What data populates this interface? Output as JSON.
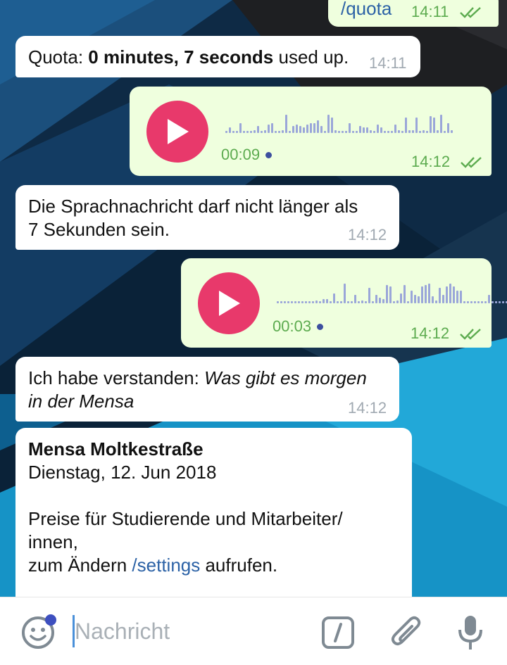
{
  "messages": [
    {
      "id": "m0",
      "dir": "out",
      "text": "/quota",
      "time": "14:11",
      "read": true
    },
    {
      "id": "m1",
      "dir": "in",
      "text_prefix": "Quota: ",
      "text_bold": "0 minutes, 7 seconds",
      "text_suffix": " used up.",
      "time": "14:11"
    },
    {
      "id": "m2",
      "dir": "out",
      "type": "voice",
      "duration": "00:09",
      "time": "14:12",
      "read": true
    },
    {
      "id": "m3",
      "dir": "in",
      "line1": "Die Sprachnachricht darf nicht länger als",
      "line2": "7 Sekunden sein.",
      "time": "14:12"
    },
    {
      "id": "m4",
      "dir": "out",
      "type": "voice",
      "duration": "00:03",
      "time": "14:12",
      "read": true
    },
    {
      "id": "m5",
      "dir": "in",
      "prefix": "Ich habe verstanden: ",
      "italic_line1": "Was gibt es morgen",
      "italic_line2": "in der Mensa",
      "time": "14:12"
    },
    {
      "id": "m6",
      "dir": "in",
      "title": "Mensa Moltkestraße",
      "date": "Dienstag, 12. Jun 2018",
      "line1": "Preise für Studierende und Mitarbeiter/",
      "line2": "innen,",
      "line3_prefix": "zum Ändern ",
      "line3_link": "/settings",
      "line3_suffix": " aufrufen."
    }
  ],
  "composer": {
    "placeholder": "Nachricht",
    "emoji_icon": "emoji-icon",
    "commands_icon": "slash-commands-icon",
    "attach_icon": "paperclip-icon",
    "mic_icon": "microphone-icon"
  },
  "colors": {
    "outgoing_bubble": "#efffde",
    "incoming_bubble": "#ffffff",
    "play_button": "#e8396b",
    "time_out": "#5cab4f",
    "link": "#2c62a6"
  }
}
